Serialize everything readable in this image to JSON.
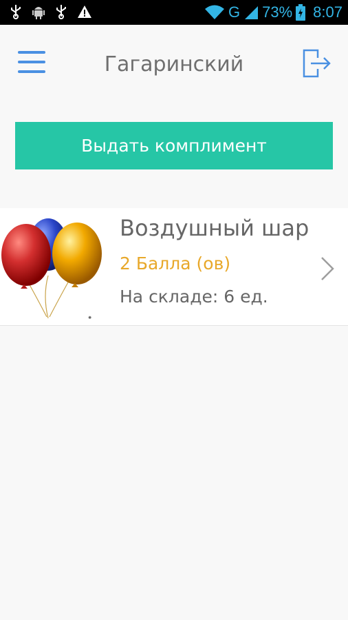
{
  "status_bar": {
    "network": "G",
    "battery_percent": "73%",
    "time": "8:07",
    "accent_color": "#33b5e5"
  },
  "header": {
    "title": "Гагаринский",
    "menu_icon": "hamburger-menu-icon",
    "logout_icon": "logout-icon",
    "accent_color": "#4a90e2"
  },
  "action_button": {
    "label": "Выдать комплимент",
    "color": "#26c6a6"
  },
  "items": [
    {
      "name": "Воздушный шар",
      "points": "2 Балла (ов)",
      "stock": "На складе: 6 ед.",
      "image": "balloons-image",
      "points_color": "#e8a82a"
    }
  ]
}
